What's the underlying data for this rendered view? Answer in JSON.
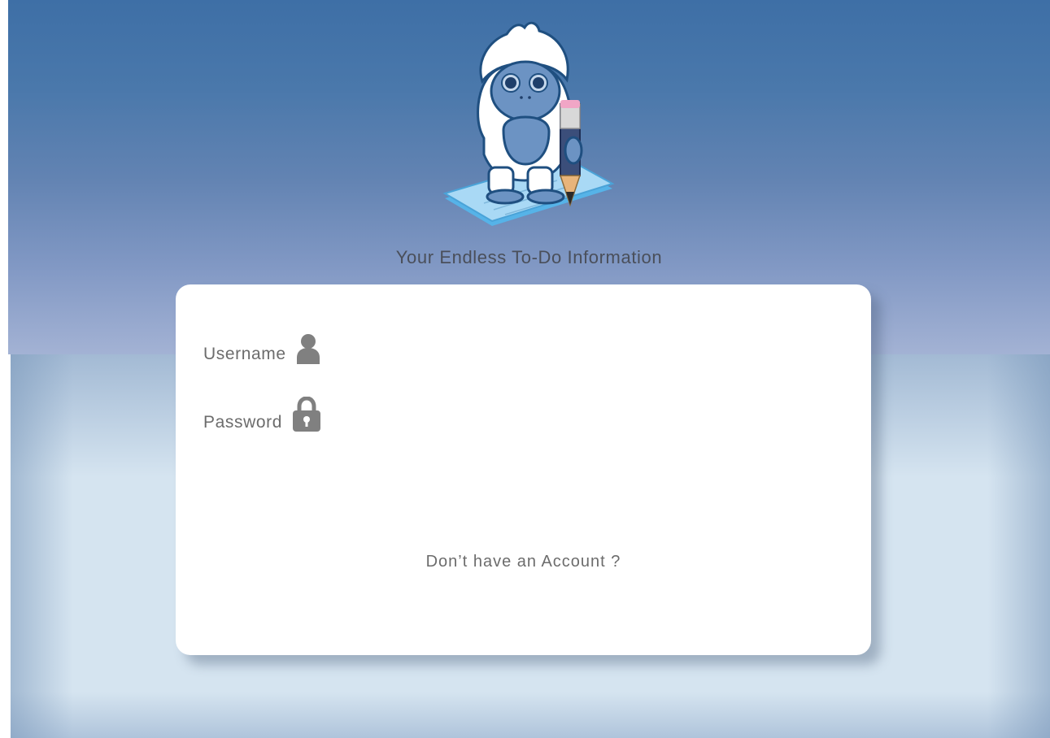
{
  "header": {
    "tagline": "Your Endless To-Do Information",
    "mascot_icon": "yeti-with-pencil-icon"
  },
  "login_form": {
    "username_label": "Username",
    "username_icon": "user-icon",
    "password_label": "Password",
    "password_icon": "lock-icon",
    "signup_link": "Don’t have an Account ?"
  },
  "colors": {
    "sky_top": "#3e6fa6",
    "sky_bottom": "#a3b2d4",
    "floor": "#d5e4f0",
    "card": "#ffffff",
    "label_text": "#6c6c6c",
    "tagline_text": "#4a4f5a",
    "icon_gray": "#808080"
  }
}
